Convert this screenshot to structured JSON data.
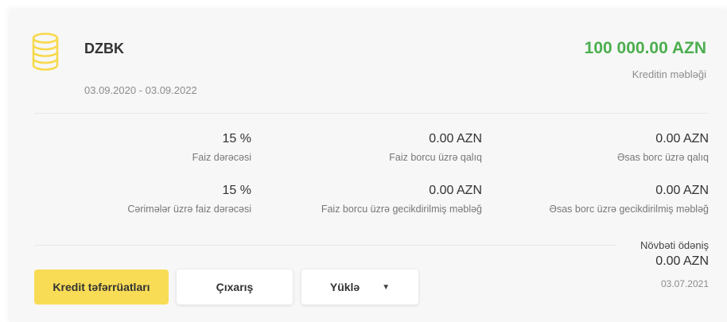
{
  "loan": {
    "name": "DZBK",
    "period": "03.09.2020 - 03.09.2022",
    "amount": "100 000.00 AZN",
    "amount_label": "Kreditin məbləği"
  },
  "stats": {
    "interest_rate": {
      "value": "15 %",
      "label": "Faiz dərəcəsi"
    },
    "interest_debt_balance": {
      "value": "0.00 AZN",
      "label": "Faiz borcu üzrə qalıq"
    },
    "principal_debt_balance": {
      "value": "0.00 AZN",
      "label": "Əsas borc üzrə qalıq"
    },
    "penalty_rate": {
      "value": "15 %",
      "label": "Cərimələr üzrə faiz dərəcəsi"
    },
    "interest_overdue": {
      "value": "0.00 AZN",
      "label": "Faiz borcu üzrə gecikdirilmiş məbləğ"
    },
    "principal_overdue": {
      "value": "0.00 AZN",
      "label": "Əsas borc üzrə gecikdirilmiş məbləğ"
    }
  },
  "next_payment": {
    "title": "Növbəti ödəniş",
    "amount": "0.00 AZN",
    "date": "03.07.2021"
  },
  "buttons": {
    "details": "Kredit təfərrüatları",
    "statement": "Çıxarış",
    "download": "Yüklə"
  },
  "colors": {
    "amount": "#4cae4f",
    "primary_button": "#f9dc56",
    "icon": "#f7d94c"
  },
  "icons": {
    "loan": "coin-stack-icon",
    "dropdown": "chevron-down-icon"
  }
}
